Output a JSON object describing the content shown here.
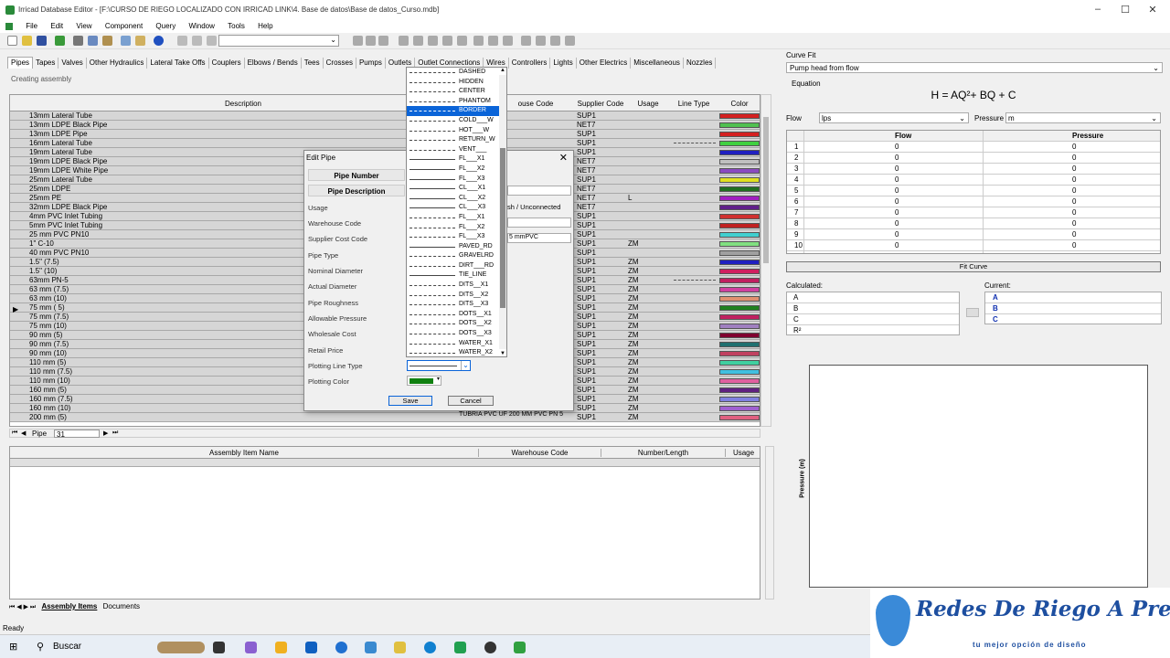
{
  "window": {
    "title": "Irricad Database Editor - [F:\\CURSO DE RIEGO LOCALIZADO  CON IRRICAD LINK\\4. Base de datos\\Base de datos_Curso.mdb]"
  },
  "menu": [
    "File",
    "Edit",
    "View",
    "Component",
    "Query",
    "Window",
    "Tools",
    "Help"
  ],
  "tabs": [
    "Pipes",
    "Tapes",
    "Valves",
    "Other Hydraulics",
    "Lateral Take Offs",
    "Couplers",
    "Elbows / Bends",
    "Tees",
    "Crosses",
    "Pumps",
    "Outlets",
    "Outlet Connections",
    "Wires",
    "Controllers",
    "Lights",
    "Other Electrics",
    "Miscellaneous",
    "Nozzles"
  ],
  "status_creating": "Creating assembly",
  "grid": {
    "headers": {
      "description": "Description",
      "warehouse": "ouse Code",
      "supplier": "Supplier Code",
      "usage": "Usage",
      "line_type": "Line Type",
      "color": "Color"
    },
    "rows": [
      {
        "d": "13mm  Lateral Tube",
        "s": "SUP1",
        "u": "",
        "c": "#d42020"
      },
      {
        "d": "13mm LDPE Black Pipe",
        "s": "NET7",
        "u": "",
        "c": "#50c050"
      },
      {
        "d": "13mm LDPE Pipe",
        "s": "SUP1",
        "u": "",
        "c": "#d42020"
      },
      {
        "d": "16mm  Lateral Tube",
        "s": "SUP1",
        "u": "",
        "c": "#40d040",
        "lt": "dash"
      },
      {
        "d": "19mm  Lateral Tube",
        "s": "SUP1",
        "u": "",
        "c": "#2020c0"
      },
      {
        "d": "19mm LDPE Black Pipe",
        "s": "NET7",
        "u": "",
        "c": "#c0c0c0"
      },
      {
        "d": "19mm LDPE White Pipe",
        "s": "NET7",
        "u": "",
        "c": "#8a4ac0"
      },
      {
        "d": "25mm  Lateral Tube",
        "s": "SUP1",
        "u": "",
        "c": "#e0e020"
      },
      {
        "d": "25mm LDPE",
        "s": "NET7",
        "u": "",
        "c": "#207020"
      },
      {
        "d": "25mm PE",
        "s": "NET7",
        "u": "L",
        "c": "#a020c0"
      },
      {
        "d": "32mm LDPE Black Pipe",
        "s": "NET7",
        "u": "",
        "c": "#60208a"
      },
      {
        "d": "4mm PVC Inlet Tubing",
        "s": "SUP1",
        "u": "",
        "c": "#d03030"
      },
      {
        "d": "5mm PVC Inlet Tubing",
        "s": "SUP1",
        "u": "",
        "c": "#c02020"
      },
      {
        "d": "25 mm PVC PN10",
        "s": "SUP1",
        "u": "",
        "c": "#40d0d0"
      },
      {
        "d": "1\" C-10",
        "s": "SUP1",
        "u": "ZM",
        "c": "#80e080"
      },
      {
        "d": "40 mm PVC PN10",
        "s": "SUP1",
        "u": "",
        "c": "#a0a0a0"
      },
      {
        "d": "1.5\" (7.5)",
        "s": "SUP1",
        "u": "ZM",
        "c": "#2020c0"
      },
      {
        "d": "1.5\" (10)",
        "s": "SUP1",
        "u": "ZM",
        "c": "#d02060"
      },
      {
        "d": "63mm PN-5",
        "s": "SUP1",
        "u": "ZM",
        "c": "#c02060",
        "lt": "dash"
      },
      {
        "d": "63 mm (7.5)",
        "s": "SUP1",
        "u": "ZM",
        "c": "#d040a0"
      },
      {
        "d": "63 mm (10)",
        "s": "SUP1",
        "u": "ZM",
        "c": "#e09070"
      },
      {
        "d": "75 mm ( 5)",
        "s": "SUP1",
        "u": "ZM",
        "c": "#208020"
      },
      {
        "d": "75 mm (7.5)",
        "s": "SUP1",
        "u": "ZM",
        "c": "#c02060"
      },
      {
        "d": "75 mm (10)",
        "s": "SUP1",
        "u": "ZM",
        "c": "#a080c0"
      },
      {
        "d": "90 mm (5)",
        "s": "SUP1",
        "u": "ZM",
        "c": "#800030"
      },
      {
        "d": "90 mm (7.5)",
        "s": "SUP1",
        "u": "ZM",
        "c": "#207070"
      },
      {
        "d": "90 mm (10)",
        "s": "SUP1",
        "u": "ZM",
        "c": "#c04060"
      },
      {
        "d": "110 mm (5)",
        "s": "SUP1",
        "u": "ZM",
        "c": "#40d0a0"
      },
      {
        "d": "110 mm (7.5)",
        "s": "SUP1",
        "u": "ZM",
        "c": "#40c0e0"
      },
      {
        "d": "110 mm (10)",
        "s": "SUP1",
        "u": "ZM",
        "c": "#e060a0"
      },
      {
        "d": "160 mm (5)",
        "s": "SUP1",
        "u": "ZM",
        "c": "#602080"
      },
      {
        "d": "160 mm (7.5)",
        "s": "SUP1",
        "u": "ZM",
        "c": "#8080e0"
      },
      {
        "d": "160 mm (10)",
        "s": "SUP1",
        "u": "ZM",
        "c": "#a060d0"
      },
      {
        "d": "200 mm (5)",
        "s": "SUP1",
        "u": "ZM",
        "c": "#e06080"
      }
    ],
    "visible_code_last": "TUBRIA PVC UF 200 MM PVC PN 5",
    "nav_label": "Pipe",
    "nav_value": "31"
  },
  "dialog": {
    "title": "Edit Pipe",
    "pipe_number": "Pipe Number",
    "pipe_description": "Pipe Description",
    "labels": [
      "Usage",
      "Warehouse Code",
      "Supplier Cost Code",
      "Pipe Type",
      "Nominal Diameter",
      "Actual Diameter",
      "Pipe Roughness",
      "Allowable Pressure",
      "Wholesale Cost",
      "Retail Price",
      "Plotting Line Type",
      "Plotting Color"
    ],
    "usage_value": "sh / Unconnected",
    "supplier_value": "5 mmPVC",
    "save": "Save",
    "cancel": "Cancel"
  },
  "dropdown": {
    "options": [
      "DASHED",
      "HIDDEN",
      "CENTER",
      "PHANTOM",
      "BORDER",
      "COLD___W",
      "HOT___W",
      "RETURN_W",
      "VENT___",
      "FL___X1",
      "FL___X2",
      "FL___X3",
      "CL___X1",
      "CL___X2",
      "CL___X3",
      "FL___X1",
      "FL___X2",
      "FL___X3",
      "PAVED_RD",
      "GRAVELRD",
      "DIRT___RD",
      "TIE_LINE",
      "DITS__X1",
      "DITS__X2",
      "DITS__X3",
      "DOTS__X1",
      "DOTS__X2",
      "DOTS__X3",
      "WATER_X1",
      "WATER_X2"
    ],
    "selected": "BORDER"
  },
  "assembly": {
    "headers": [
      "Assembly Item Name",
      "Warehouse Code",
      "Number/Length",
      "Usage"
    ],
    "tabs": [
      "Assembly Items",
      "Documents"
    ]
  },
  "curve": {
    "title": "Curve Fit",
    "type": "Pump head from flow",
    "equation_label": "Equation",
    "equation": "H = AQ²+ BQ + C",
    "flow_label": "Flow",
    "flow_unit": "lps",
    "pressure_label": "Pressure",
    "pressure_unit": "m",
    "headers": [
      "Flow",
      "Pressure"
    ],
    "rows": [
      [
        "1",
        "0",
        "0"
      ],
      [
        "2",
        "0",
        "0"
      ],
      [
        "3",
        "0",
        "0"
      ],
      [
        "4",
        "0",
        "0"
      ],
      [
        "5",
        "0",
        "0"
      ],
      [
        "6",
        "0",
        "0"
      ],
      [
        "7",
        "0",
        "0"
      ],
      [
        "8",
        "0",
        "0"
      ],
      [
        "9",
        "0",
        "0"
      ],
      [
        "10",
        "0",
        "0"
      ]
    ],
    "fit_button": "Fit Curve",
    "calculated": "Calculated:",
    "current": "Current:",
    "coeffs": [
      "A",
      "B",
      "C",
      "R²"
    ],
    "axis_label": "Pressure (m)"
  },
  "status": "Ready",
  "taskbar": {
    "search": "Buscar"
  },
  "logo": {
    "title": "Redes De Riego A Presión",
    "tagline": "tu mejor opción de diseño"
  }
}
